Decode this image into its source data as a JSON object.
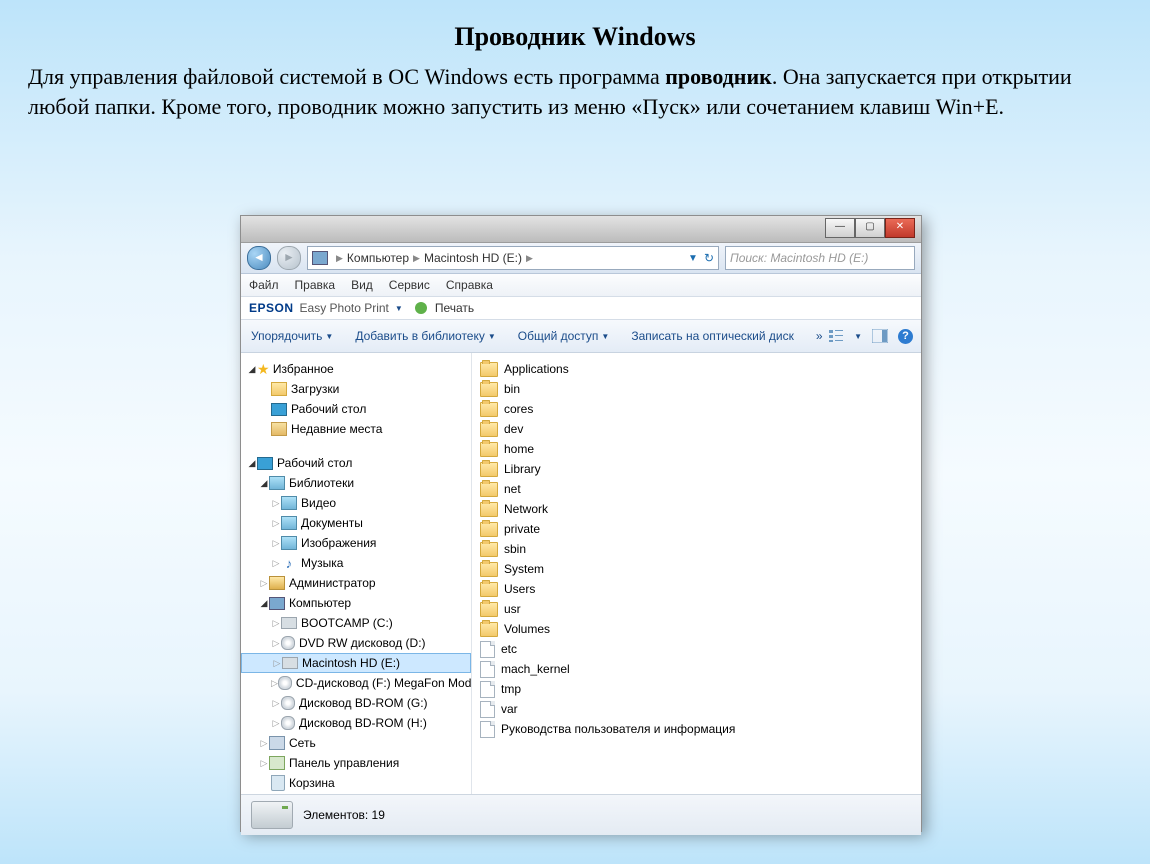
{
  "slide": {
    "title": "Проводник Windows",
    "para_1a": "Для управления файловой системой в ОС Windows есть программа ",
    "para_1b": "проводник",
    "para_1c": ". Она запускается при открытии любой папки. Кроме того, проводник можно запустить из меню «Пуск» или сочетанием клавиш Win+E."
  },
  "breadcrumb": {
    "seg1": "Компьютер",
    "seg2": "Macintosh HD (E:)"
  },
  "search": {
    "placeholder": "Поиск: Macintosh HD (E:)"
  },
  "menubar": {
    "file": "Файл",
    "edit": "Правка",
    "view": "Вид",
    "service": "Сервис",
    "help": "Справка"
  },
  "epson": {
    "logo": "EPSON",
    "text": "Easy Photo Print",
    "print": "Печать"
  },
  "toolbar": {
    "organize": "Упорядочить",
    "addlib": "Добавить в библиотеку",
    "share": "Общий доступ",
    "burn": "Записать на оптический диск",
    "more": "»"
  },
  "nav": {
    "favorites": "Избранное",
    "downloads": "Загрузки",
    "desktop": "Рабочий стол",
    "recent": "Недавние места",
    "desktop2": "Рабочий стол",
    "libraries": "Библиотеки",
    "video": "Видео",
    "documents": "Документы",
    "pictures": "Изображения",
    "music": "Музыка",
    "admin": "Администратор",
    "computer": "Компьютер",
    "bootcamp": "BOOTCAMP (C:)",
    "dvdrw": "DVD RW дисковод (D:)",
    "machd": "Macintosh HD (E:)",
    "cddrive": "CD-дисковод (F:) MegaFon Modem",
    "bdg": "Дисковод BD-ROM (G:)",
    "bdh": "Дисковод BD-ROM (H:)",
    "network": "Сеть",
    "control": "Панель управления",
    "recycle": "Корзина"
  },
  "files": {
    "f0": "Applications",
    "f1": "bin",
    "f2": "cores",
    "f3": "dev",
    "f4": "home",
    "f5": "Library",
    "f6": "net",
    "f7": "Network",
    "f8": "private",
    "f9": "sbin",
    "f10": "System",
    "f11": "Users",
    "f12": "usr",
    "f13": "Volumes",
    "d0": "etc",
    "d1": "mach_kernel",
    "d2": "tmp",
    "d3": "var",
    "d4": "Руководства пользователя и информация"
  },
  "status": {
    "label": "Элементов: 19"
  }
}
